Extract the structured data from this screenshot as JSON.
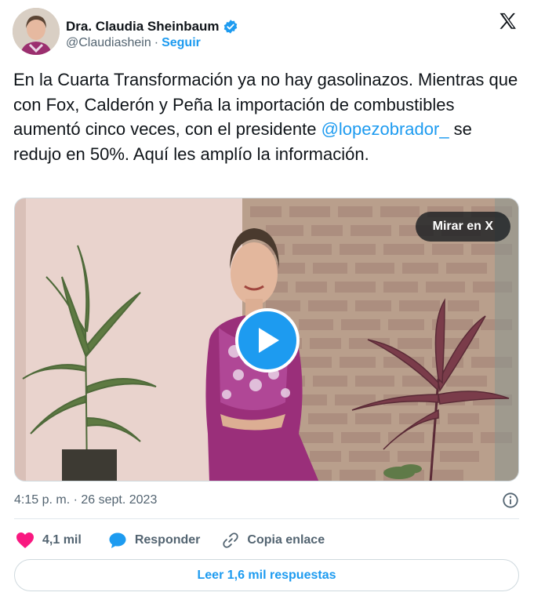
{
  "author": {
    "display_name": "Dra. Claudia Sheinbaum",
    "handle": "@Claudiashein",
    "separator": "·",
    "follow_label": "Seguir"
  },
  "tweet": {
    "text_before_mention": "En la Cuarta Transformación ya no hay gasolinazos. Mientras que con Fox, Calderón y Peña la importación de combustibles aumentó cinco veces, con el presidente ",
    "mention": "@lopezobrador_",
    "text_after_mention": " se redujo en 50%. Aquí les amplío la información."
  },
  "media": {
    "watch_label": "Mirar en X"
  },
  "meta": {
    "timestamp": "4:15 p. m. · 26 sept. 2023"
  },
  "actions": {
    "likes_count": "4,1 mil",
    "reply_label": "Responder",
    "copy_link_label": "Copia enlace"
  },
  "read_replies_label": "Leer 1,6 mil respuestas",
  "colors": {
    "accent": "#1d9bf0",
    "heart": "#f91880",
    "text_secondary": "#536471"
  }
}
